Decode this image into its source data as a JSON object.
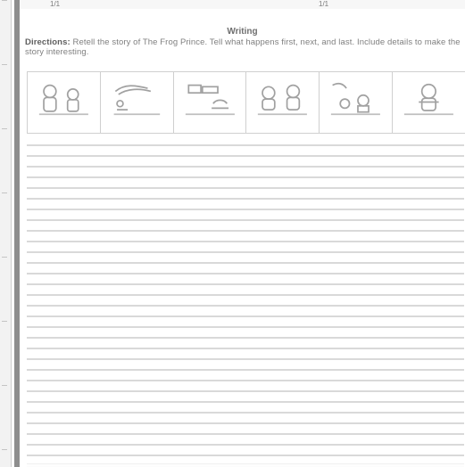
{
  "header": {
    "ruler_left": "1/1",
    "ruler_right": "1/1"
  },
  "worksheet": {
    "title": "Writing",
    "directions_label": "Directions:",
    "directions_text": "Retell the story of The Frog Prince. Tell what happens first, next, and last. Include details to make the story interesting."
  },
  "panels": [
    {
      "name": "panel-1"
    },
    {
      "name": "panel-2"
    },
    {
      "name": "panel-3"
    },
    {
      "name": "panel-4"
    },
    {
      "name": "panel-5"
    },
    {
      "name": "panel-6"
    }
  ]
}
